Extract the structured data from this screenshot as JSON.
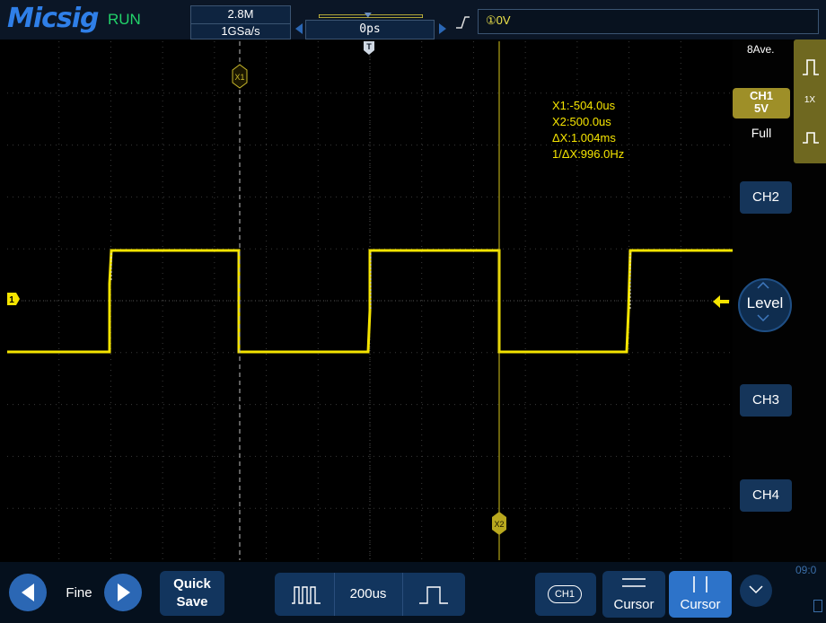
{
  "top_bar": {
    "brand": "Micsig",
    "run_state": "RUN",
    "memory_depth": "2.8M",
    "sample_rate": "1GSa/s",
    "horizontal_position": "0ps",
    "trigger_level": "①0V"
  },
  "display": {
    "trigger_marker": "T",
    "channel_marker": "1",
    "cursor_x1_label": "X1",
    "cursor_x2_label": "X2",
    "readout": {
      "x1": "X1:-504.0us",
      "x2": "X2:500.0us",
      "dx": "ΔX:1.004ms",
      "inv_dx": "1/ΔX:996.0Hz"
    }
  },
  "right_panel": {
    "average": "8Ave.",
    "ch1_name": "CH1",
    "ch1_scale": "5V",
    "ch1_bandwidth": "Full",
    "ch1_probe": "1X",
    "ch2_label": "CH2",
    "level_label": "Level",
    "ch3_label": "CH3",
    "ch4_label": "CH4"
  },
  "bottom_bar": {
    "fine_label": "Fine",
    "quick_save_line1": "Quick",
    "quick_save_line2": "Save",
    "timebase": "200us",
    "cursor_channel": "CH1",
    "cursor_h_label": "Cursor",
    "cursor_v_label": "Cursor",
    "clock": "09:0"
  },
  "colors": {
    "trace": "#f5e400",
    "cursor": "#d6c61a",
    "accent": "#2b67b4",
    "grid": "#3a3a3a"
  }
}
